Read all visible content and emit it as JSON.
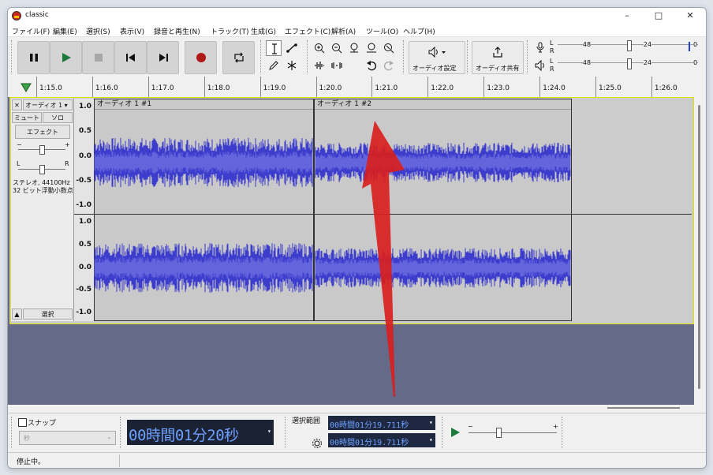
{
  "window": {
    "title": "classic"
  },
  "menu": [
    "ファイル(F)",
    "編集(E)",
    "選択(S)",
    "表示(V)",
    "録音と再生(N)",
    "トラック(T)",
    "生成(G)",
    "エフェクト(C)",
    "解析(A)",
    "ツール(O)",
    "ヘルプ(H)"
  ],
  "toolbar": {
    "audio_setup_label": "オーディオ設定",
    "share_label": "オーディオ共有",
    "meter": {
      "l": "L",
      "r": "R",
      "ticks": [
        "-48",
        "-24",
        "0"
      ]
    }
  },
  "ruler": {
    "ticks": [
      "1:15.0",
      "1:16.0",
      "1:17.0",
      "1:18.0",
      "1:19.0",
      "1:20.0",
      "1:21.0",
      "1:22.0",
      "1:23.0",
      "1:24.0",
      "1:25.0",
      "1:26.0"
    ]
  },
  "track": {
    "name": "オーディオ 1",
    "mute": "ミュート",
    "solo": "ソロ",
    "effects": "エフェクト",
    "gain_minus": "−",
    "gain_plus": "+",
    "pan_l": "L",
    "pan_r": "R",
    "info_line1": "ステレオ, 44100Hz",
    "info_line2": "32 ビット浮動小数点数",
    "select": "選択",
    "scale": [
      "1.0",
      "0.5",
      "0.0",
      "-0.5",
      "-1.0"
    ],
    "clips": [
      {
        "title": "オーディオ 1 #1"
      },
      {
        "title": "オーディオ 1 #2"
      }
    ]
  },
  "selection": {
    "snap_label": "スナップ",
    "snap_unit": "秒",
    "time": "00時間01分20秒",
    "range_label": "選択範囲",
    "start": "00時間01分19.711秒",
    "end": "00時間01分19.711秒"
  },
  "status": {
    "text": "停止中。"
  },
  "colors": {
    "wave": "#3c3ccd",
    "wave_rms": "#6464dc",
    "background": "#646a87",
    "arrow": "#d8201e"
  }
}
